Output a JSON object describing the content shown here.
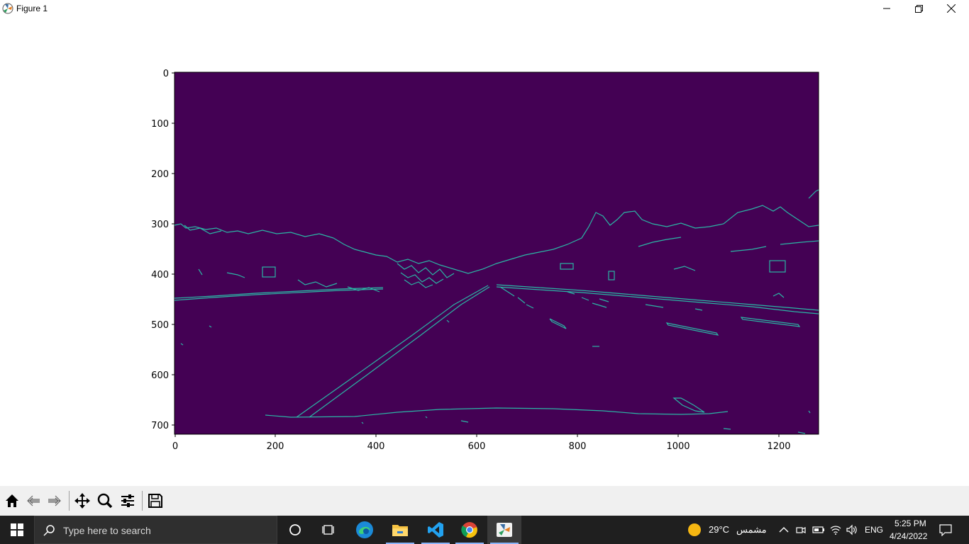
{
  "window": {
    "title": "Figure 1",
    "controls": [
      "minimize",
      "restore",
      "close"
    ]
  },
  "plot": {
    "colormap": "viridis",
    "background_color": "#440154",
    "edge_color": "#35b779",
    "x_ticks": [
      "0",
      "200",
      "400",
      "600",
      "800",
      "1000",
      "1200"
    ],
    "y_ticks": [
      "0",
      "100",
      "200",
      "300",
      "400",
      "500",
      "600",
      "700"
    ],
    "xlim": [
      0,
      1280
    ],
    "ylim": [
      720,
      0
    ]
  },
  "toolbar": {
    "buttons": [
      "home-icon",
      "back-icon",
      "forward-icon",
      "pan-icon",
      "zoom-icon",
      "configure-subplots-icon",
      "save-icon"
    ]
  },
  "taskbar": {
    "search_placeholder": "Type here to search",
    "apps": [
      "cortana-icon",
      "task-view-icon",
      "edge-icon",
      "file-explorer-icon",
      "vscode-icon",
      "chrome-icon",
      "python-figure-icon"
    ],
    "weather_temp": "29°C",
    "weather_text": "مشمس",
    "language": "ENG",
    "time": "5:25 PM",
    "date": "4/24/2022"
  }
}
